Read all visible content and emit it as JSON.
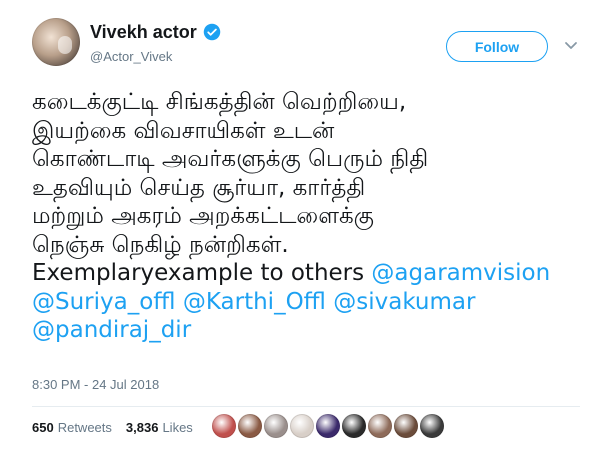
{
  "author": {
    "display_name": "Vivekh actor",
    "handle": "@Actor_Vivek",
    "verified": true
  },
  "follow_button": {
    "label": "Follow"
  },
  "tweet": {
    "lines": [
      [
        {
          "text": "கடைக்குட்டி சிங்கத்தின் வெற்றியை,",
          "type": "text"
        }
      ],
      [
        {
          "text": "இயற்கை விவசாயிகள் உடன்",
          "type": "text"
        }
      ],
      [
        {
          "text": "கொண்டாடி அவர்களுக்கு பெரும் நிதி",
          "type": "text"
        }
      ],
      [
        {
          "text": "உதவியும் செய்த சூர்யா, கார்த்தி",
          "type": "text"
        }
      ],
      [
        {
          "text": "மற்றும் அகரம் அறக்கட்டளைக்கு",
          "type": "text"
        }
      ],
      [
        {
          "text": "நெஞ்சு நெகிழ் நன்றிகள்.",
          "type": "text"
        }
      ],
      [
        {
          "text": "Exemplaryexample to others ",
          "type": "text"
        },
        {
          "text": "@agaramvision",
          "type": "mention"
        }
      ],
      [
        {
          "text": "@Suriya_offl",
          "type": "mention"
        },
        {
          "text": " ",
          "type": "text"
        },
        {
          "text": "@Karthi_Offl",
          "type": "mention"
        },
        {
          "text": " ",
          "type": "text"
        },
        {
          "text": "@sivakumar",
          "type": "mention"
        }
      ],
      [
        {
          "text": "@pandiraj_dir",
          "type": "mention"
        }
      ]
    ]
  },
  "timestamp": "8:30 PM - 24 Jul 2018",
  "stats": {
    "retweets_count": "650",
    "retweets_label": "Retweets",
    "likes_count": "3,836",
    "likes_label": "Likes"
  },
  "liker_avatar_colors": [
    "#c0504d",
    "#8a5a44",
    "#9a8f8c",
    "#d8cfc8",
    "#3b2a6b",
    "#2b2b2b",
    "#8e6b5a",
    "#6b4c3b",
    "#3a3a3a"
  ],
  "colors": {
    "accent": "#1da1f2",
    "muted": "#657786",
    "text": "#14171a"
  },
  "icons": {
    "verified": "verified-badge-icon",
    "menu": "chevron-down-icon"
  }
}
